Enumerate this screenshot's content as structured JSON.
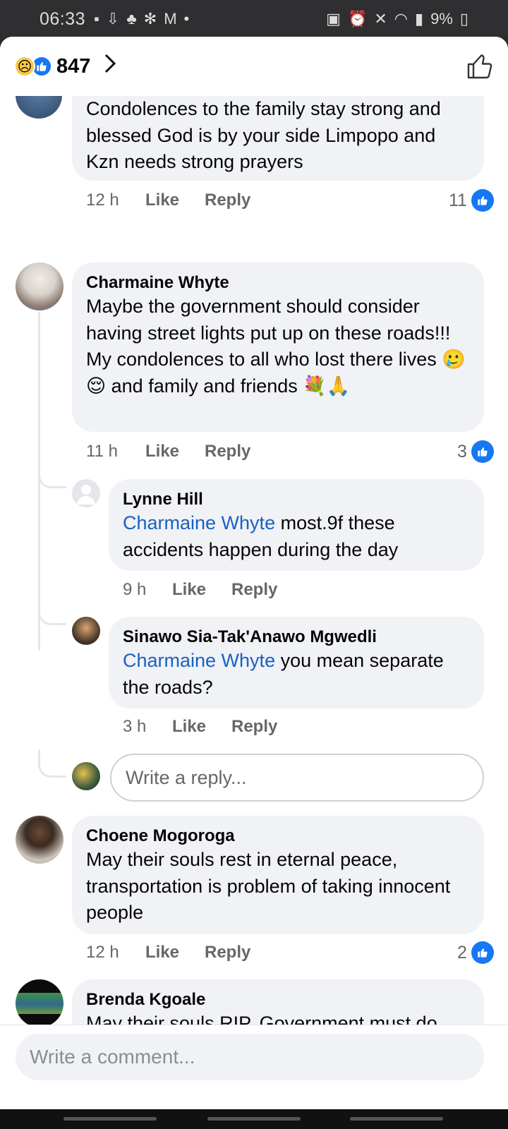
{
  "status_bar": {
    "time": "06:33",
    "battery": "9%"
  },
  "header": {
    "reaction_count": "847"
  },
  "comments": [
    {
      "name": "",
      "text": "Condolences to the family stay strong and blessed God is by your side Limpopo and Kzn needs strong prayers",
      "time": "12 h",
      "like": "Like",
      "reply": "Reply",
      "likes": "11"
    },
    {
      "name": "Charmaine Whyte",
      "text": "Maybe the government should consider having street lights put up on these roads!!! My condolences to all who lost there lives 🥲😌 and family and friends 💐🙏",
      "time": "11 h",
      "like": "Like",
      "reply": "Reply",
      "likes": "3",
      "replies": [
        {
          "name": "Lynne Hill",
          "mention": "Charmaine Whyte",
          "text": " most.9f these accidents happen during the day",
          "time": "9 h",
          "like": "Like",
          "reply": "Reply"
        },
        {
          "name": "Sinawo Sia-Tak'Anawo Mgwedli",
          "mention": "Charmaine Whyte",
          "text": " you mean separate the roads?",
          "time": "3 h",
          "like": "Like",
          "reply": "Reply"
        }
      ],
      "reply_placeholder": "Write a reply..."
    },
    {
      "name": "Choene Mogoroga",
      "text": "May their souls rest in eternal peace, transportation is problem of taking innocent people",
      "time": "12 h",
      "like": "Like",
      "reply": "Reply",
      "likes": "2"
    },
    {
      "name": "Brenda Kgoale",
      "text": "May their souls RIP. Government must do something about the road"
    }
  ],
  "footer": {
    "comment_placeholder": "Write a comment..."
  },
  "colors": {
    "accent": "#1877f2",
    "mention": "#1861c4",
    "bubble": "#f0f2f5"
  }
}
